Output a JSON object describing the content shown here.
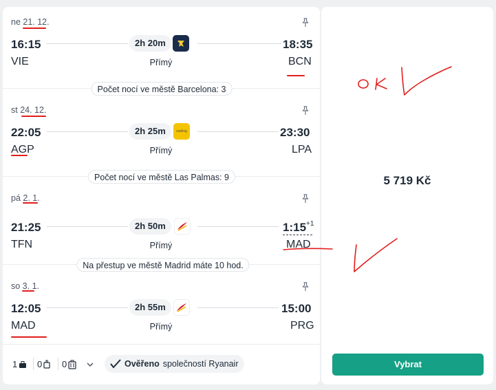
{
  "segments": [
    {
      "date": "ne 21. 12.",
      "dep_time": "16:15",
      "arr_time": "18:35",
      "arr_plus": "",
      "dep_iata": "VIE",
      "arr_iata": "BCN",
      "duration": "2h 20m",
      "stops": "Přímý",
      "airline_icon": "ryanair-logo"
    },
    {
      "date": "st 24. 12.",
      "dep_time": "22:05",
      "arr_time": "23:30",
      "arr_plus": "",
      "dep_iata": "AGP",
      "arr_iata": "LPA",
      "duration": "2h 25m",
      "stops": "Přímý",
      "airline_icon": "vueling-logo",
      "airline_text": "vueling"
    },
    {
      "date": "pá 2. 1.",
      "dep_time": "21:25",
      "arr_time": "1:15",
      "arr_plus": "+1",
      "dep_iata": "TFN",
      "arr_iata": "MAD",
      "duration": "2h 50m",
      "stops": "Přímý",
      "airline_icon": "iberia-logo"
    },
    {
      "date": "so 3. 1.",
      "dep_time": "12:05",
      "arr_time": "15:00",
      "arr_plus": "",
      "dep_iata": "MAD",
      "arr_iata": "PRG",
      "duration": "2h 55m",
      "stops": "Přímý",
      "airline_icon": "iberia-logo"
    }
  ],
  "nights": [
    "Počet nocí ve městě Barcelona: 3",
    "Počet nocí ve městě Las Palmas: 9",
    "Na přestup ve městě Madrid máte 10 hod."
  ],
  "footer": {
    "cabin_bags": "1",
    "personal_items": "0",
    "checked_bags": "0",
    "verified_bold": "Ověřeno",
    "verified_rest": "společností Ryanair"
  },
  "price": "5 719 Kč",
  "select_label": "Vybrat",
  "handwritten_note": "OK",
  "colors": {
    "accent": "#16a085",
    "annotation": "#e11d1d",
    "ryanair": "#1a2b4c",
    "vueling": "#f5c400",
    "iberia": "#d7192d"
  }
}
